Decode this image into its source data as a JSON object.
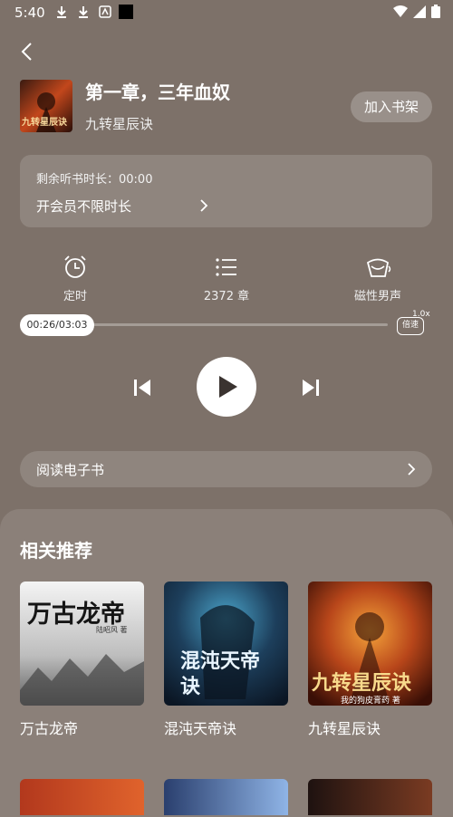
{
  "status_bar": {
    "time": "5:40"
  },
  "header": {
    "chapter_title": "第一章，三年血奴",
    "book_name": "九转星辰诀",
    "add_shelf_label": "加入书架",
    "cover_text": "九转星辰诀"
  },
  "vip": {
    "remaining_label": "剩余听书时长：00:00",
    "unlimited_label": "开会员不限时长"
  },
  "functions": {
    "timer_label": "定时",
    "chapters_label": "2372 章",
    "voice_label": "磁性男声"
  },
  "player": {
    "time_display": "00:26/03:03",
    "progress": 0.142,
    "speed_label": "倍速",
    "speed_value": "1.0x"
  },
  "ebook": {
    "label": "阅读电子书"
  },
  "recommendations": {
    "title": "相关推荐",
    "items": [
      {
        "name": "万古龙帝",
        "cover_title": "万古龙帝",
        "cover_author": "陆昭风 著"
      },
      {
        "name": "混沌天帝诀",
        "cover_title": "混沌天帝诀"
      },
      {
        "name": "九转星辰诀",
        "cover_title": "九转星辰诀",
        "cover_author": "我的狗皮膏药 著"
      }
    ]
  },
  "colors": {
    "background": "#7d7169",
    "sheet": "#8b8079",
    "accent": "#ffffff"
  },
  "icons": [
    "back-icon",
    "alarm-icon",
    "list-icon",
    "headphones-icon",
    "prev-icon",
    "play-icon",
    "next-icon",
    "chevron-right-icon"
  ]
}
